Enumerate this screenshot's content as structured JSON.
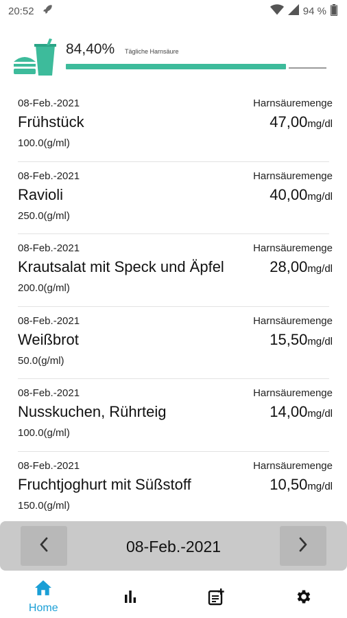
{
  "status_bar": {
    "time": "20:52",
    "battery": "94 %",
    "icons": [
      "rocket-icon",
      "wifi-icon",
      "signal-icon",
      "battery-icon"
    ]
  },
  "summary": {
    "percent_text": "84,40%",
    "label": "Tägliche Harnsäure",
    "progress": 0.844,
    "accent_color": "#3dbb9b"
  },
  "entries": [
    {
      "date": "08-Feb.-2021",
      "quantity_label": "Harnsäuremenge",
      "name": "Frühstück",
      "value": "47,00",
      "unit": "mg/dl",
      "amount": "100.0(g/ml)"
    },
    {
      "date": "08-Feb.-2021",
      "quantity_label": "Harnsäuremenge",
      "name": "Ravioli",
      "value": "40,00",
      "unit": "mg/dl",
      "amount": "250.0(g/ml)"
    },
    {
      "date": "08-Feb.-2021",
      "quantity_label": "Harnsäuremenge",
      "name": "Krautsalat mit Speck und Äpfel",
      "value": "28,00",
      "unit": "mg/dl",
      "amount": "200.0(g/ml)"
    },
    {
      "date": "08-Feb.-2021",
      "quantity_label": "Harnsäuremenge",
      "name": "Weißbrot",
      "value": "15,50",
      "unit": "mg/dl",
      "amount": "50.0(g/ml)"
    },
    {
      "date": "08-Feb.-2021",
      "quantity_label": "Harnsäuremenge",
      "name": "Nusskuchen, Rührteig",
      "value": "14,00",
      "unit": "mg/dl",
      "amount": "100.0(g/ml)"
    },
    {
      "date": "08-Feb.-2021",
      "quantity_label": "Harnsäuremenge",
      "name": "Fruchtjoghurt mit Süßstoff",
      "value": "10,50",
      "unit": "mg/dl",
      "amount": "150.0(g/ml)"
    }
  ],
  "date_nav": {
    "current_date": "08-Feb.-2021",
    "prev_icon": "chevron-left-icon",
    "next_icon": "chevron-right-icon"
  },
  "bottom_nav": {
    "active_color": "#1a9fd6",
    "tabs": [
      {
        "icon": "home-icon",
        "label": "Home",
        "active": true
      },
      {
        "icon": "bar-chart-icon",
        "label": "",
        "active": false
      },
      {
        "icon": "add-note-icon",
        "label": "",
        "active": false
      },
      {
        "icon": "gear-icon",
        "label": "",
        "active": false
      }
    ]
  }
}
